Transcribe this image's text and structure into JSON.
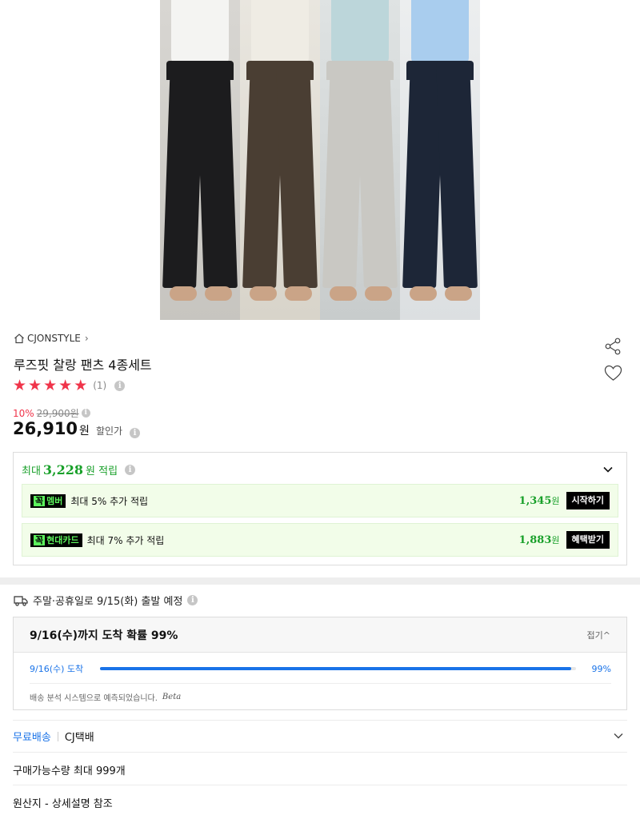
{
  "product": {
    "brand": "CJONSTYLE",
    "brand_chevron": "›",
    "title": "루즈핏 찰랑 팬츠 4종세트",
    "rating": {
      "stars": 5,
      "max": 5,
      "count_text": "(1)"
    },
    "discount_pct": "10%",
    "original_price": "29,900원",
    "price": "26,910",
    "price_unit": "원",
    "price_label": "할인가",
    "image_panels": [
      {
        "pants": "#1c1c1e",
        "top": "#f4f4f2"
      },
      {
        "pants": "#4a3e33",
        "top": "#efece4"
      },
      {
        "pants": "#c9c8c3",
        "top": "#bcd6da"
      },
      {
        "pants": "#1d2637",
        "top": "#a9cdee"
      }
    ]
  },
  "points": {
    "head_prefix": "최대",
    "head_amount": "3,228",
    "head_suffix": "원 적립",
    "rows": [
      {
        "tag_g": "꼭",
        "tag": "멤버",
        "desc": "최대 5% 추가 적립",
        "amount": "1,345",
        "unit": "원",
        "button": "시작하기"
      },
      {
        "tag_g": "꼭",
        "tag": "현대카드",
        "desc": "최대 7% 추가 적립",
        "amount": "1,883",
        "unit": "원",
        "button": "혜택받기"
      }
    ],
    "accent_color": "#19a02a"
  },
  "delivery": {
    "notice": "주말·공휴일로 9/15(화) 출발 예정",
    "arrival_title": "9/16(수)까지 도착 확률 99%",
    "fold_label": "접기^",
    "arrival_date": "9/16(수) 도착",
    "probability": 0.99,
    "probability_label": "99%",
    "footnote": "배송 분석 시스템으로 예측되었습니다.",
    "beta": "Beta",
    "fee": "무료배송",
    "carrier": "CJ택배"
  },
  "purchase_limit": "구매가능수량 최대 999개",
  "origin": "원산지 - 상세설명 참조",
  "colors": {
    "accent_red": "#f0344a",
    "accent_blue": "#1a73e8"
  }
}
